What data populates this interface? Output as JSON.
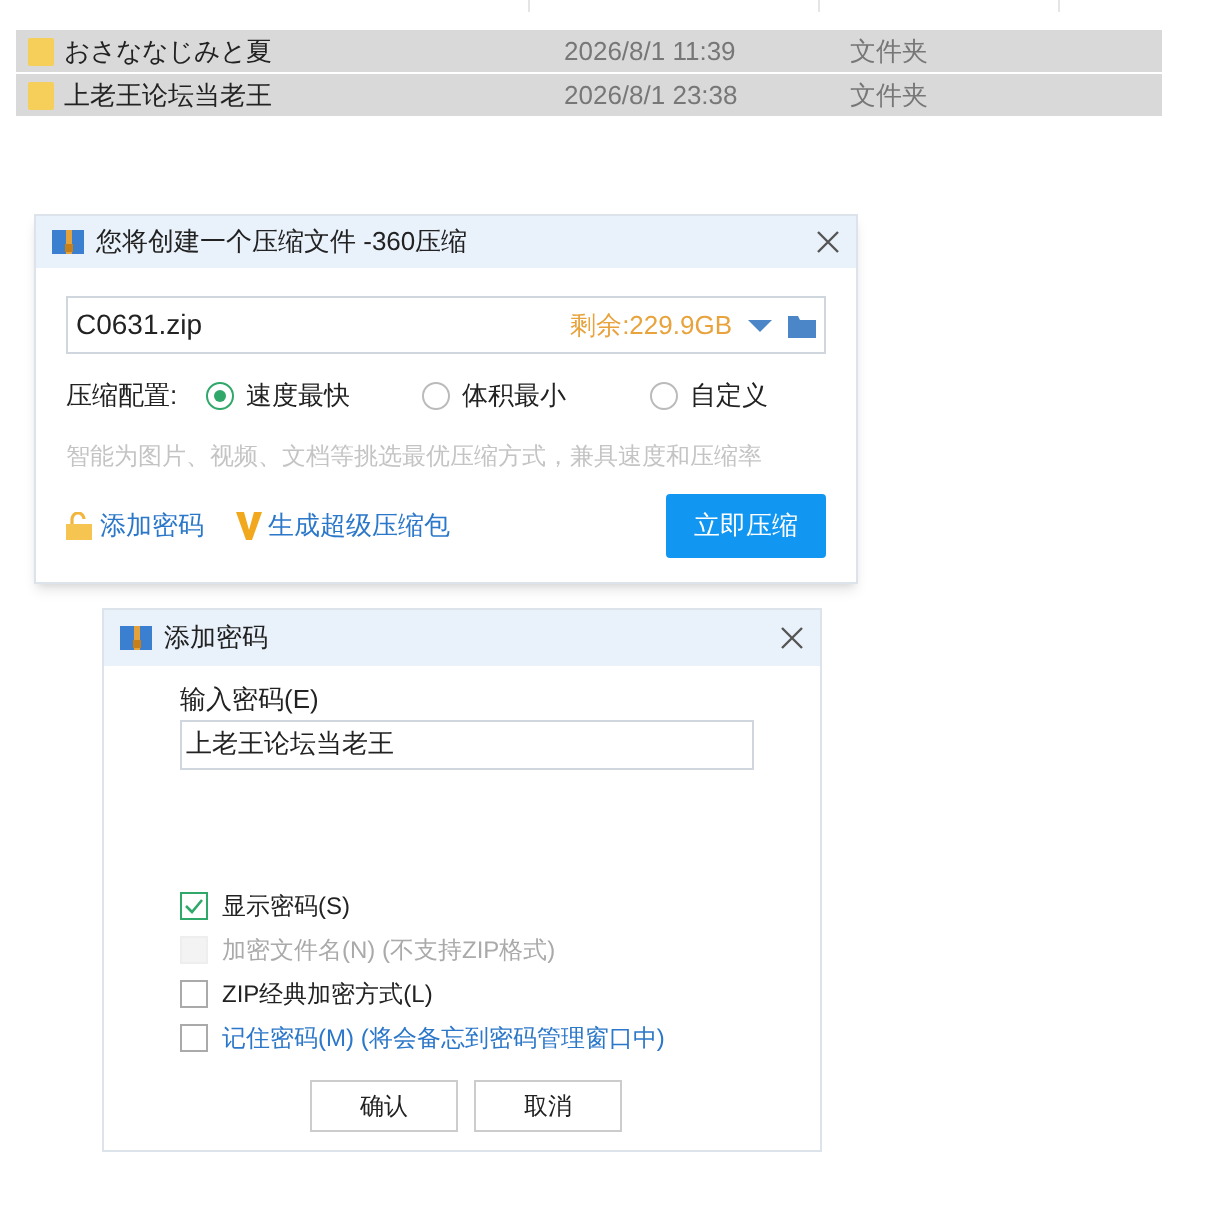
{
  "file_list": {
    "rows": [
      {
        "name": "おさななじみと夏",
        "modified": "2026/8/1 11:39",
        "type": "文件夹",
        "selected": true
      },
      {
        "name": "上老王论坛当老王",
        "modified": "2026/8/1 23:38",
        "type": "文件夹",
        "selected": true
      }
    ]
  },
  "compress_dialog": {
    "title": "您将创建一个压缩文件 -360压缩",
    "filename": "C0631.zip",
    "free_space": "剩余:229.9GB",
    "config_label": "压缩配置:",
    "options": [
      {
        "label": "速度最快",
        "selected": true
      },
      {
        "label": "体积最小",
        "selected": false
      },
      {
        "label": "自定义",
        "selected": false
      }
    ],
    "hint": "智能为图片、视频、文档等挑选最优压缩方式，兼具速度和压缩率",
    "add_password": "添加密码",
    "super_package": "生成超级压缩包",
    "compress_button": "立即压缩"
  },
  "password_dialog": {
    "title": "添加密码",
    "input_label": "输入密码(E)",
    "password": "上老王论坛当老王",
    "options": [
      {
        "label": "显示密码(S)",
        "checked": true,
        "disabled": false,
        "kind": "plain"
      },
      {
        "label": "加密文件名(N) (不支持ZIP格式)",
        "checked": false,
        "disabled": true,
        "kind": "plain"
      },
      {
        "label": "ZIP经典加密方式(L)",
        "checked": false,
        "disabled": false,
        "kind": "plain"
      },
      {
        "label": "记住密码(M) (将会备忘到密码管理窗口中)",
        "checked": false,
        "disabled": false,
        "kind": "link"
      }
    ],
    "buttons": [
      "确认",
      "取消"
    ]
  }
}
